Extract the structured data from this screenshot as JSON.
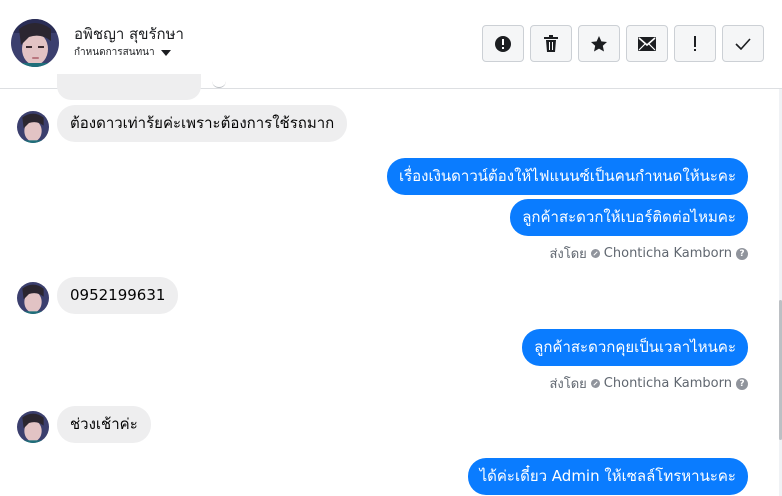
{
  "header": {
    "contact_name": "อพิชญา สุขรักษา",
    "assign_label": "กำหนดการสนทนา",
    "actions": [
      {
        "name": "report-button",
        "icon": "alert-circle-icon"
      },
      {
        "name": "delete-button",
        "icon": "trash-icon"
      },
      {
        "name": "star-button",
        "icon": "star-icon"
      },
      {
        "name": "mark-unread-button",
        "icon": "envelope-icon"
      },
      {
        "name": "important-button",
        "icon": "exclamation-icon"
      },
      {
        "name": "done-button",
        "icon": "check-icon"
      }
    ]
  },
  "messages": [
    {
      "direction": "in",
      "text": "ต้องดาวเท่าร้ยค่ะเพราะต้องการใช้รถมาก"
    },
    {
      "direction": "out",
      "text": "เรื่องเงินดาวน์ต้องให้ไฟแนนซ์เป็นคนกำหนดให้นะคะ"
    },
    {
      "direction": "out",
      "text": "ลูกค้าสะดวกให้เบอร์ติดต่อไหมคะ"
    },
    {
      "direction": "in",
      "text": "0952199631"
    },
    {
      "direction": "out",
      "text": "ลูกค้าสะดวกคุยเป็นเวลาไหนคะ"
    },
    {
      "direction": "in",
      "text": "ช่วงเช้าค่ะ"
    },
    {
      "direction": "out",
      "text": "ได้ค่ะเดี๋ยว Admin ให้เซลล์โทรหานะคะ"
    }
  ],
  "sent_by": {
    "prefix": "ส่งโดย",
    "agent": "Chonticha Kamborn"
  },
  "colors": {
    "outgoing_bubble": "#0a7cff",
    "incoming_bubble": "#eeeeef",
    "meta_text": "#606770"
  }
}
